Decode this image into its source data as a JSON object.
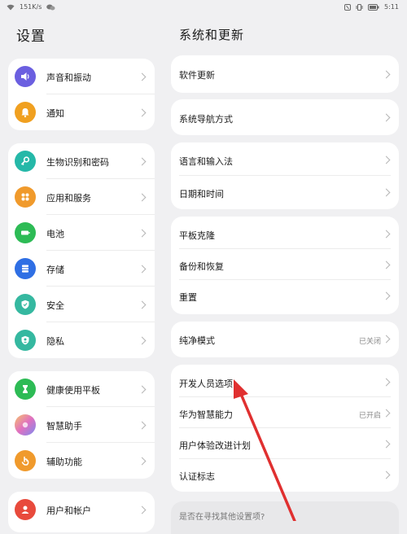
{
  "status_bar": {
    "net_speed": "151K/s",
    "time": "5:11"
  },
  "left_pane": {
    "title": "设置",
    "groups": [
      {
        "items": [
          {
            "label": "声音和振动",
            "icon": "speaker-icon",
            "color": "#6b5fe0"
          },
          {
            "label": "通知",
            "icon": "bell-icon",
            "color": "#f0a020"
          }
        ]
      },
      {
        "items": [
          {
            "label": "生物识别和密码",
            "icon": "key-icon",
            "color": "#25b8a8"
          },
          {
            "label": "应用和服务",
            "icon": "apps-grid-icon",
            "color": "#f09a2c"
          },
          {
            "label": "电池",
            "icon": "battery-icon",
            "color": "#2dbb55"
          },
          {
            "label": "存储",
            "icon": "storage-icon",
            "color": "#2f6fe4"
          },
          {
            "label": "安全",
            "icon": "shield-icon",
            "color": "#35b8a0"
          },
          {
            "label": "隐私",
            "icon": "privacy-icon",
            "color": "#35b8a0"
          }
        ]
      },
      {
        "items": [
          {
            "label": "健康使用平板",
            "icon": "hourglass-icon",
            "color": "#2dbb55"
          },
          {
            "label": "智慧助手",
            "icon": "assistant-icon",
            "color": "#e070c0"
          },
          {
            "label": "辅助功能",
            "icon": "hand-icon",
            "color": "#f09a2c"
          }
        ]
      },
      {
        "items": [
          {
            "label": "用户和帐户",
            "icon": "user-icon",
            "color": "#e84a3c"
          }
        ]
      }
    ]
  },
  "right_pane": {
    "title": "系统和更新",
    "groups": [
      {
        "items": [
          {
            "label": "软件更新",
            "value": ""
          }
        ]
      },
      {
        "items": [
          {
            "label": "系统导航方式",
            "value": ""
          }
        ]
      },
      {
        "items": [
          {
            "label": "语言和输入法",
            "value": ""
          },
          {
            "label": "日期和时间",
            "value": ""
          }
        ]
      },
      {
        "items": [
          {
            "label": "平板克隆",
            "value": ""
          },
          {
            "label": "备份和恢复",
            "value": ""
          },
          {
            "label": "重置",
            "value": ""
          }
        ]
      },
      {
        "items": [
          {
            "label": "纯净模式",
            "value": "已关闭"
          }
        ]
      },
      {
        "items": [
          {
            "label": "开发人员选项",
            "value": ""
          },
          {
            "label": "华为智慧能力",
            "value": "已开启"
          },
          {
            "label": "用户体验改进计划",
            "value": ""
          },
          {
            "label": "认证标志",
            "value": ""
          }
        ]
      }
    ],
    "hint": "是否在寻找其他设置项?"
  },
  "annotation": {
    "arrow_color": "#e03030"
  }
}
